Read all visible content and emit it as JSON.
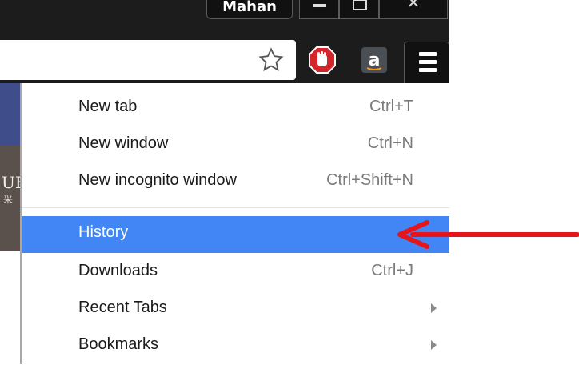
{
  "window": {
    "profile_name": "Mahan"
  },
  "toolbar": {
    "bookmark_icon": "star-outline-icon",
    "extensions": [
      "stop-hand-icon",
      "amazon-icon"
    ],
    "menu_icon": "hamburger-menu-icon"
  },
  "page": {
    "partial_text": "UE",
    "partial_subtext": "采"
  },
  "menu": {
    "items": [
      {
        "label": "New tab",
        "shortcut": "Ctrl+T"
      },
      {
        "label": "New window",
        "shortcut": "Ctrl+N"
      },
      {
        "label": "New incognito window",
        "shortcut": "Ctrl+Shift+N"
      },
      {
        "label": "History",
        "shortcut": "",
        "highlighted": true
      },
      {
        "label": "Downloads",
        "shortcut": "Ctrl+J"
      },
      {
        "label": "Recent Tabs",
        "submenu": true
      },
      {
        "label": "Bookmarks",
        "submenu": true
      }
    ]
  },
  "colors": {
    "highlight": "#4285f4",
    "annotation_arrow": "#e8141b",
    "chrome_dark": "#1c1c1c"
  }
}
